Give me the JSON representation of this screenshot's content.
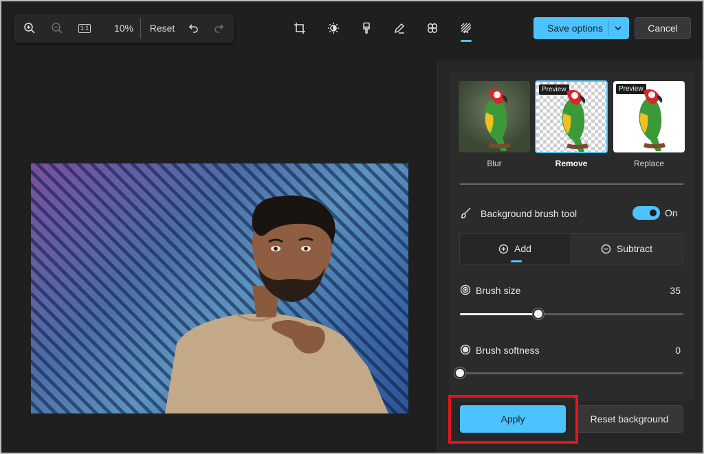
{
  "zoom_toolbar": {
    "zoom_level": "10%",
    "reset_label": "Reset",
    "actual_size_label": "1:1"
  },
  "tools": [
    "crop-icon",
    "brightness-icon",
    "retouch-brush-icon",
    "markup-pen-icon",
    "effects-icon",
    "background-icon"
  ],
  "actions": {
    "save_label": "Save options",
    "cancel_label": "Cancel"
  },
  "background_panel": {
    "options": [
      {
        "label": "Blur",
        "preview": ""
      },
      {
        "label": "Remove",
        "preview": "Preview"
      },
      {
        "label": "Replace",
        "preview": "Preview"
      }
    ],
    "selected_option": "Remove",
    "brush_tool_label": "Background brush tool",
    "brush_tool_state": "On",
    "mode_add": "Add",
    "mode_subtract": "Subtract",
    "brush_size_label": "Brush size",
    "brush_size_value": "35",
    "brush_softness_label": "Brush softness",
    "brush_softness_value": "0",
    "apply_label": "Apply",
    "reset_background_label": "Reset background"
  },
  "colors": {
    "accent": "#4cc2ff",
    "highlight": "#e3141b",
    "panel_bg": "#262626"
  }
}
